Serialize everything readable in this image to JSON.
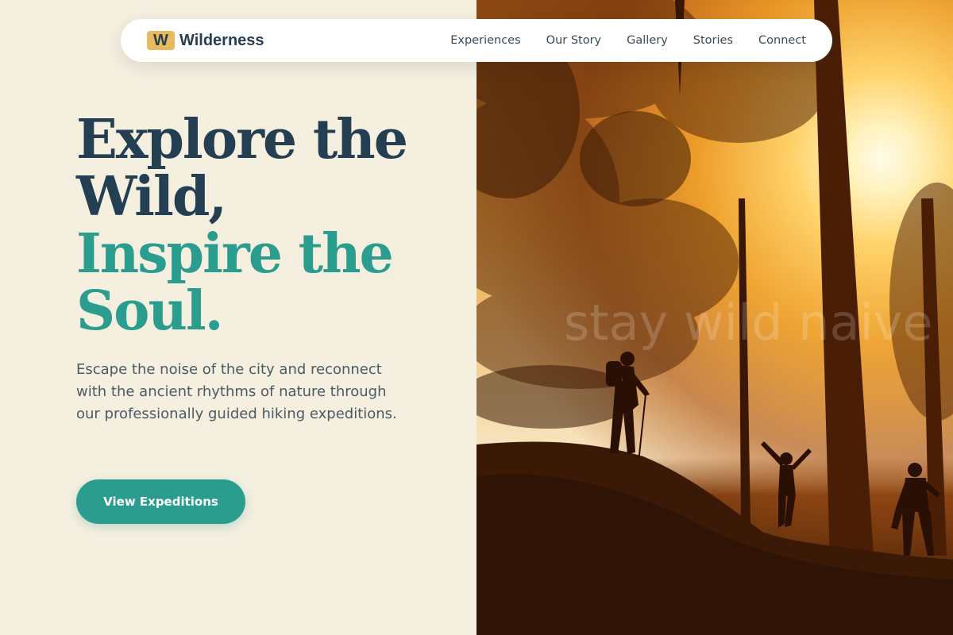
{
  "brand": {
    "badge": "W",
    "name": "Wilderness"
  },
  "nav": {
    "items": [
      "Experiences",
      "Our Story",
      "Gallery",
      "Stories",
      "Connect"
    ]
  },
  "hero": {
    "headline_lines": [
      "Explore the",
      "Wild,",
      "Inspire the",
      "Soul."
    ],
    "tagline": "Escape the noise of the city and reconnect with the ancient rhythms of nature through our professionally guided hiking expeditions.",
    "cta_label": "View Expeditions",
    "image_watermark": "stay wild naive"
  },
  "colors": {
    "page_bg": "#f5efe0",
    "navy": "#243e52",
    "teal": "#2a9d8f",
    "logo_badge": "#e8b95d",
    "body_text": "#4b5a64"
  }
}
